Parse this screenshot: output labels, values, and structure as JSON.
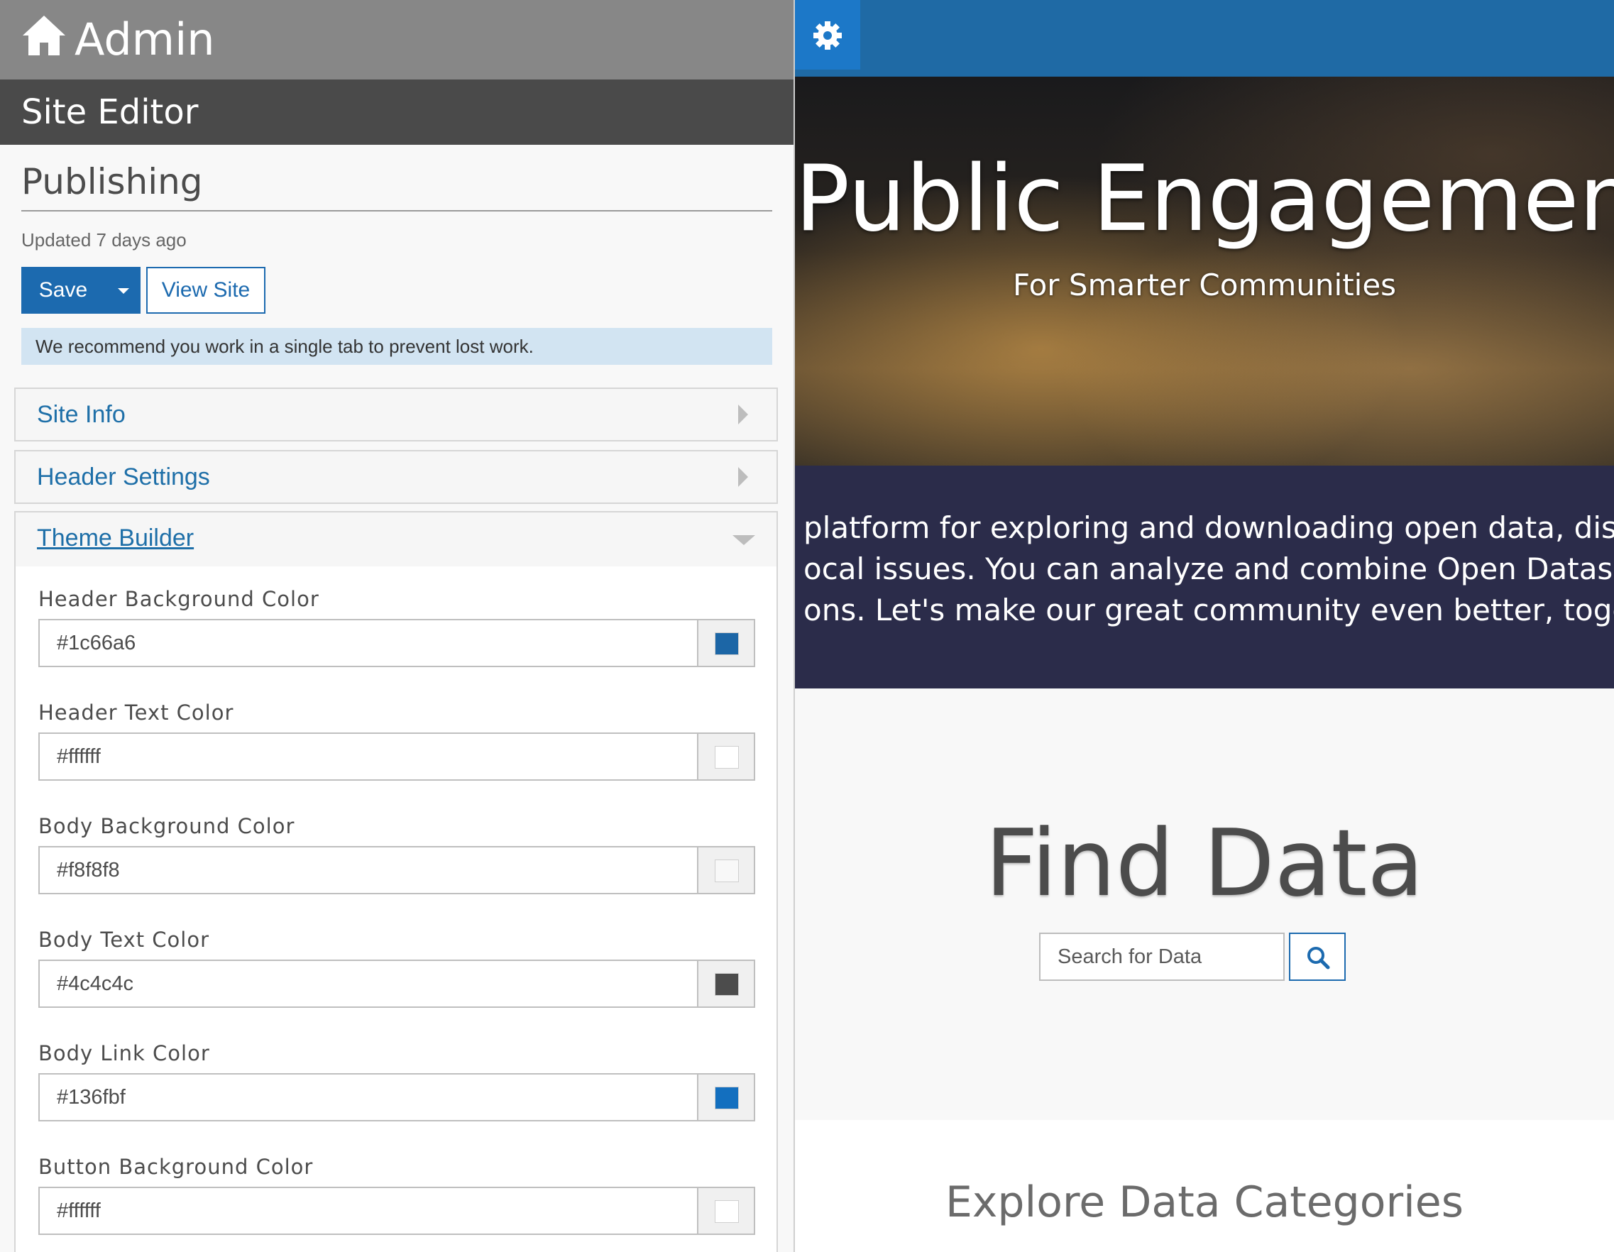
{
  "admin": {
    "title": "Admin",
    "editor_title": "Site Editor",
    "section_title": "Publishing",
    "updated": "Updated 7 days ago",
    "save_label": "Save",
    "view_site_label": "View Site",
    "notice": "We recommend you work in a single tab to prevent lost work.",
    "accordions": [
      {
        "label": "Site Info",
        "expanded": false
      },
      {
        "label": "Header Settings",
        "expanded": false
      },
      {
        "label": "Theme Builder",
        "expanded": true
      }
    ],
    "theme_fields": [
      {
        "label": "Header Background Color",
        "value": "#1c66a6",
        "swatch": "#1c66a6"
      },
      {
        "label": "Header Text Color",
        "value": "#ffffff",
        "swatch": "#ffffff"
      },
      {
        "label": "Body Background Color",
        "value": "#f8f8f8",
        "swatch": "#f8f8f8"
      },
      {
        "label": "Body Text Color",
        "value": "#4c4c4c",
        "swatch": "#4c4c4c"
      },
      {
        "label": "Body Link Color",
        "value": "#136fbf",
        "swatch": "#136fbf"
      },
      {
        "label": "Button Background Color",
        "value": "#ffffff",
        "swatch": "#ffffff"
      }
    ]
  },
  "preview": {
    "hero_title": "Public Engagement",
    "hero_subtitle": "For Smarter Communities",
    "intro_lines": [
      "platform for exploring and downloading open data, discove",
      "ocal issues. You can analyze and combine Open Datasets usi",
      "ons. Let's make our great community even better, together!"
    ],
    "find_data_title": "Find Data",
    "search_placeholder": "Search for Data",
    "categories_title": "Explore Data Categories"
  },
  "colors": {
    "admin_bar": "#878787",
    "editor_bar": "#4a4a4a",
    "accent": "#1c6aaf",
    "preview_header": "#1f6aa5",
    "intro_bg": "#2b2c4a"
  },
  "icons": [
    "home-icon",
    "caret-down-icon",
    "chevron-right-icon",
    "chevron-down-icon",
    "gear-icon",
    "search-icon"
  ]
}
